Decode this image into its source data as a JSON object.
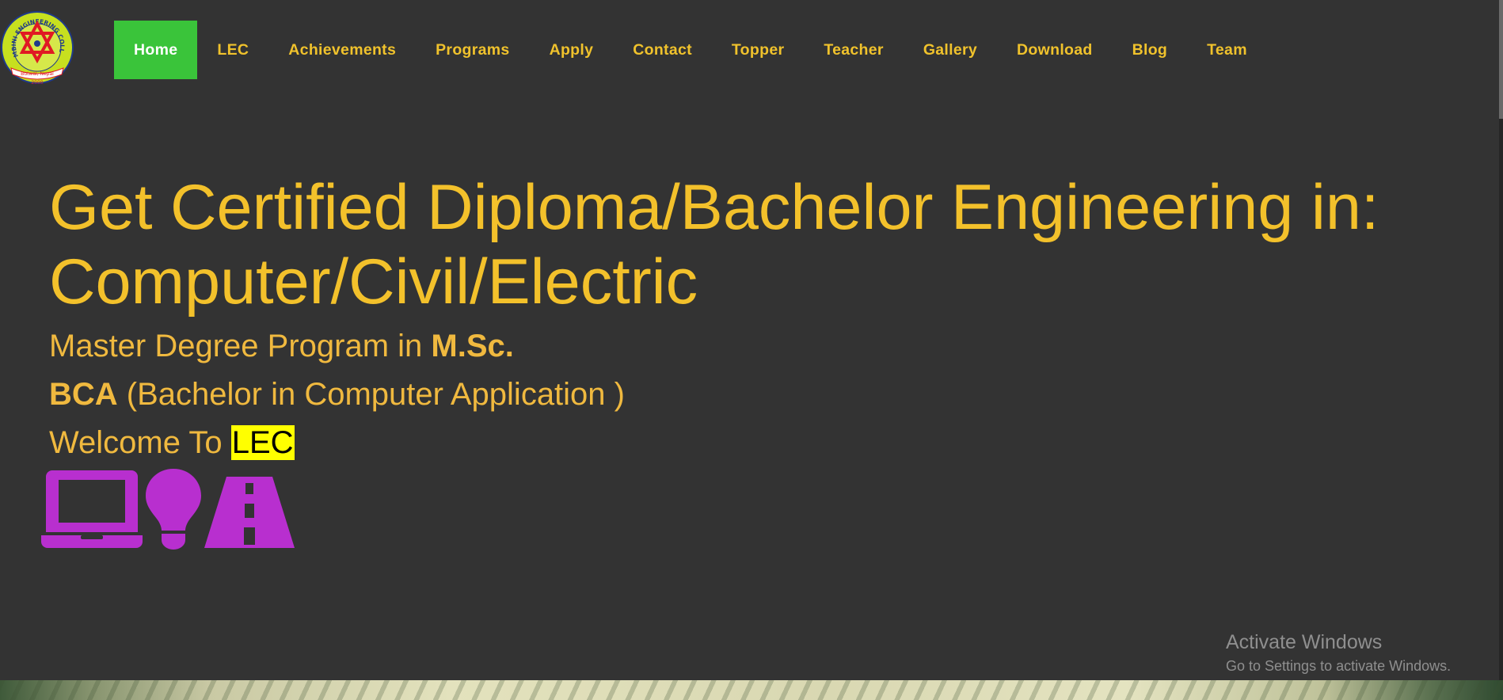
{
  "logo": {
    "ring_text": "LUMBINI ENGINEERING COLLEGE",
    "ribbon_text": "Butwal, Nepal",
    "year": "2000",
    "colors": {
      "ring": "#c7e01f",
      "star": "#e01a24",
      "border": "#1f3a8a"
    }
  },
  "nav": {
    "items": [
      {
        "label": "Home",
        "active": true
      },
      {
        "label": "LEC"
      },
      {
        "label": "Achievements"
      },
      {
        "label": "Programs"
      },
      {
        "label": "Apply"
      },
      {
        "label": "Contact"
      },
      {
        "label": "Topper"
      },
      {
        "label": "Teacher"
      },
      {
        "label": "Gallery"
      },
      {
        "label": "Download"
      },
      {
        "label": "Blog"
      },
      {
        "label": "Team"
      }
    ]
  },
  "hero": {
    "headline_line1": "Get Certified Diploma/Bachelor Engineering in:",
    "headline_line2": "Computer/Civil/Electric",
    "masters_prefix": "Master Degree Program in ",
    "masters_degree": "M.Sc.",
    "bca_abbr": "BCA",
    "bca_full": " (Bachelor in Computer Application )",
    "welcome_prefix": "Welcome To ",
    "welcome_highlight": "LEC"
  },
  "icons": [
    {
      "name": "laptop-icon"
    },
    {
      "name": "lightbulb-icon"
    },
    {
      "name": "road-icon"
    }
  ],
  "icon_color": "#b82fcf",
  "watermark": {
    "title": "Activate Windows",
    "subtitle": "Go to Settings to activate Windows."
  },
  "colors": {
    "background": "#333333",
    "nav_text": "#f0c22c",
    "nav_active_bg": "#3ac43a",
    "nav_active_text": "#ffffff",
    "headline": "#f3c12b",
    "subtext": "#f0b93f",
    "highlight_bg": "#ffff00"
  }
}
